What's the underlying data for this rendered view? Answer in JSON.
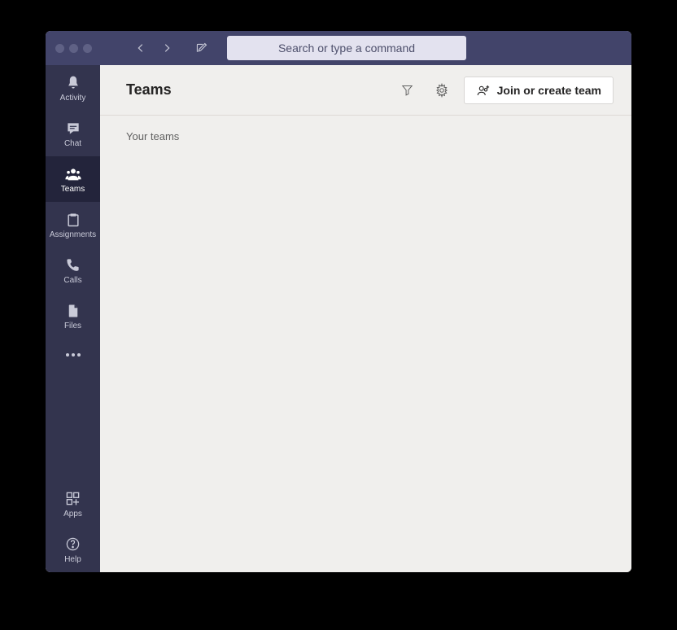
{
  "search": {
    "placeholder": "Search or type a command"
  },
  "rail": {
    "items": [
      {
        "label": "Activity"
      },
      {
        "label": "Chat"
      },
      {
        "label": "Teams"
      },
      {
        "label": "Assignments"
      },
      {
        "label": "Calls"
      },
      {
        "label": "Files"
      }
    ],
    "bottom": [
      {
        "label": "Apps"
      },
      {
        "label": "Help"
      }
    ],
    "active_index": 2
  },
  "header": {
    "title": "Teams",
    "join_label": "Join or create team"
  },
  "content": {
    "section_label": "Your teams"
  }
}
